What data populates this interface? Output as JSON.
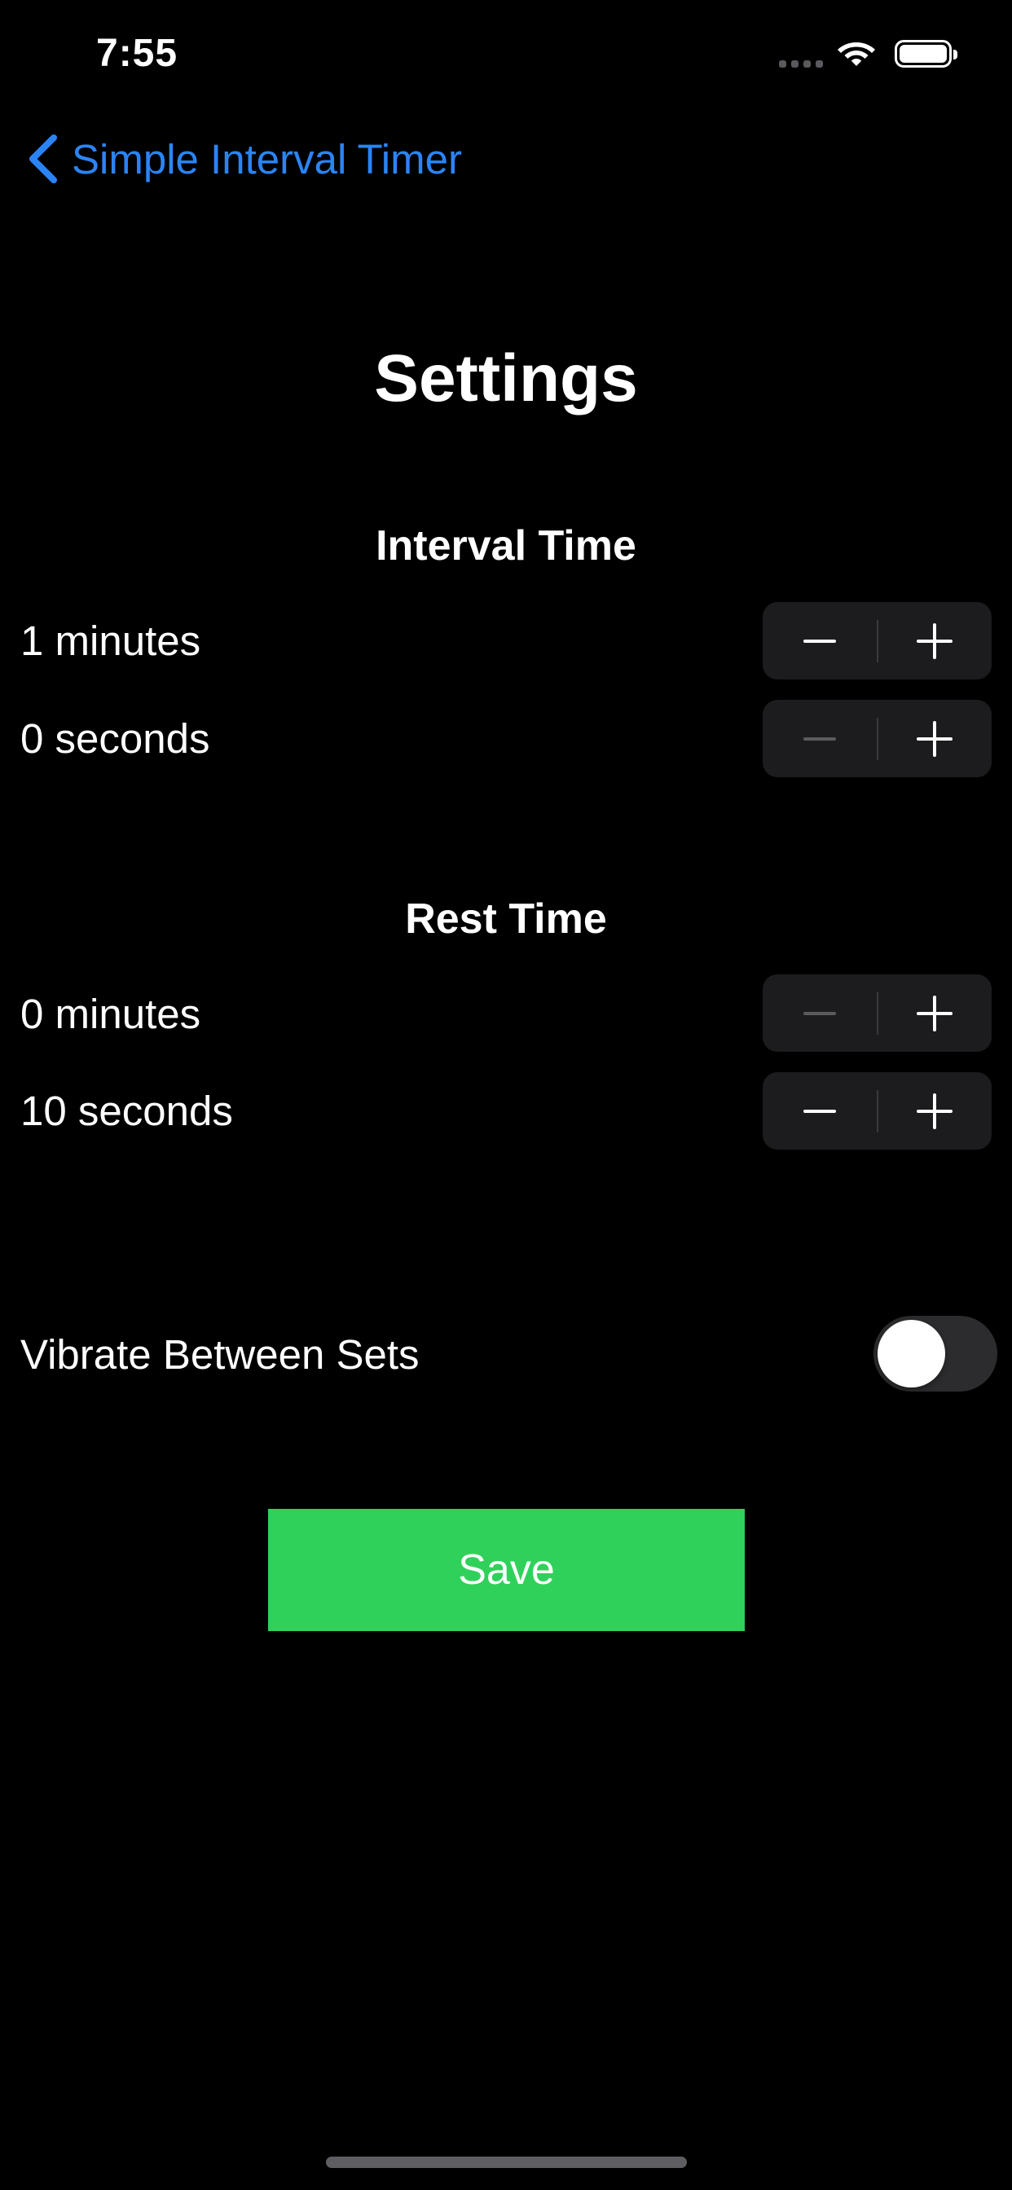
{
  "status_bar": {
    "time": "7:55",
    "signal_icon": "cellular-signal-icon",
    "wifi_icon": "wifi-icon",
    "battery_icon": "battery-icon"
  },
  "nav": {
    "back_label": "Simple Interval Timer",
    "back_icon": "chevron-left-icon"
  },
  "page": {
    "title": "Settings"
  },
  "interval": {
    "title": "Interval Time",
    "minutes_label": "1 minutes",
    "seconds_label": "0 seconds"
  },
  "rest": {
    "title": "Rest Time",
    "minutes_label": "0 minutes",
    "seconds_label": "10 seconds"
  },
  "vibrate": {
    "label": "Vibrate Between Sets",
    "enabled": false
  },
  "save_label": "Save",
  "colors": {
    "background": "#000000",
    "accent_blue": "#2b84f5",
    "save_green": "#30d15a",
    "stepper_bg": "#1c1c1e",
    "toggle_off": "#2c2c2e"
  }
}
